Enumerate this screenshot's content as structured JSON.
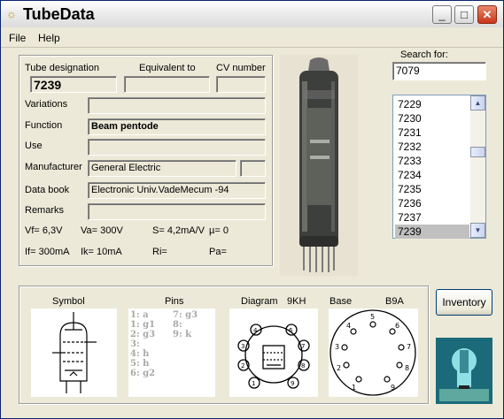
{
  "window": {
    "title": "TubeData"
  },
  "menu": {
    "file": "File",
    "help": "Help"
  },
  "labels": {
    "tube_designation": "Tube designation",
    "equivalent_to": "Equivalent to",
    "cv_number": "CV number",
    "variations": "Variations",
    "function": "Function",
    "use": "Use",
    "manufacturer": "Manufacturer",
    "data_book": "Data book",
    "remarks": "Remarks",
    "search_for": "Search for:"
  },
  "values": {
    "tube_designation": "7239",
    "equivalent_to": "",
    "cv_number": "",
    "variations": "",
    "function": "Beam pentode",
    "use": "",
    "manufacturer": "General Electric",
    "manufacturer_extra": "",
    "data_book": "Electronic Univ.VadeMecum -94",
    "remarks": "",
    "search": "7079"
  },
  "specs": {
    "vf": "Vf= 6,3V",
    "va": "Va=  300V",
    "s": "S= 4,2mA/V",
    "mu": "µ=   0",
    "if": "If= 300mA",
    "ik": "Ik=  10mA",
    "ri": "Ri=",
    "pa": "Pa="
  },
  "list": {
    "items": [
      "7229",
      "7230",
      "7231",
      "7232",
      "7233",
      "7234",
      "7235",
      "7236",
      "7237",
      "7239"
    ],
    "selected": "7239"
  },
  "bottom": {
    "symbol_label": "Symbol",
    "pins_label": "Pins",
    "diagram_label": "Diagram",
    "diagram_code": "9KH",
    "base_label": "Base",
    "base_code": "B9A",
    "pins_col1": [
      "1: a",
      "1: g1",
      "2: g3",
      "3:",
      "4: h",
      "5: h",
      "6: g2"
    ],
    "pins_col2": [
      "7: g3",
      "8:",
      "9: k"
    ]
  },
  "buttons": {
    "inventory": "Inventory"
  },
  "colors": {
    "title_bar": "#f0f0f0",
    "window_bg": "#ece9d8",
    "close_button": "#c9361a",
    "list_selection": "#c0c0c0"
  }
}
